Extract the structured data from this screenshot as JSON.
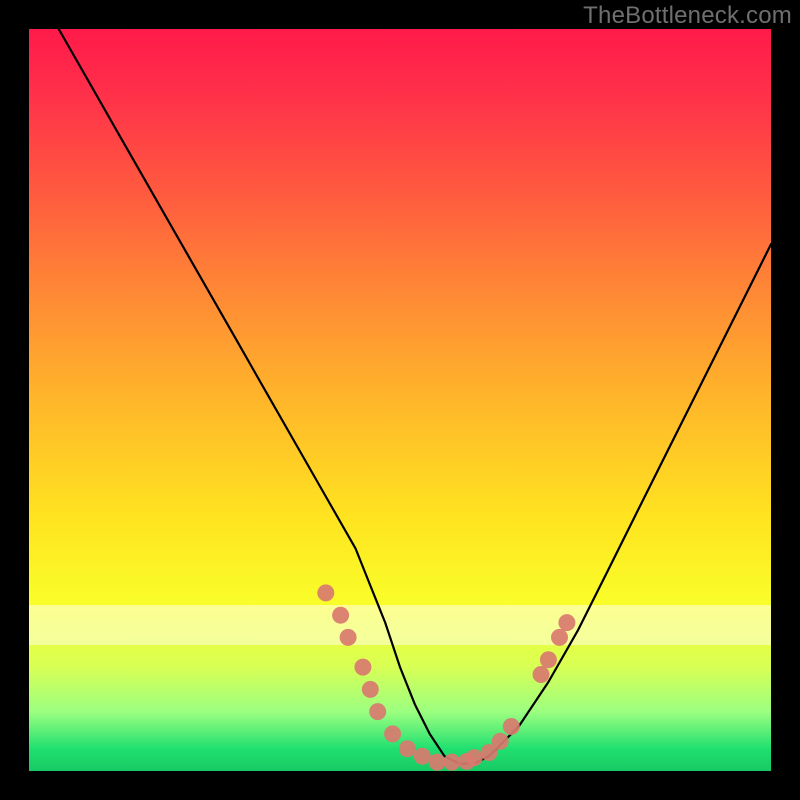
{
  "watermark": "TheBottleneck.com",
  "chart_data": {
    "type": "line",
    "title": "",
    "xlabel": "",
    "ylabel": "",
    "xlim": [
      0,
      100
    ],
    "ylim": [
      0,
      100
    ],
    "grid": false,
    "legend": false,
    "series": [
      {
        "name": "bottleneck-curve",
        "x": [
          4,
          8,
          12,
          16,
          20,
          24,
          28,
          32,
          36,
          40,
          44,
          46,
          48,
          50,
          52,
          54,
          56,
          58,
          60,
          62,
          66,
          70,
          74,
          78,
          82,
          86,
          90,
          94,
          98,
          100
        ],
        "values": [
          100,
          93,
          86,
          79,
          72,
          65,
          58,
          51,
          44,
          37,
          30,
          25,
          20,
          14,
          9,
          5,
          2,
          1,
          1,
          2,
          6,
          12,
          19,
          27,
          35,
          43,
          51,
          59,
          67,
          71
        ]
      }
    ],
    "markers": {
      "name": "highlight-band",
      "color": "#d9796f",
      "points": [
        {
          "x": 40,
          "y": 24
        },
        {
          "x": 42,
          "y": 21
        },
        {
          "x": 43,
          "y": 18
        },
        {
          "x": 45,
          "y": 14
        },
        {
          "x": 46,
          "y": 11
        },
        {
          "x": 47,
          "y": 8
        },
        {
          "x": 49,
          "y": 5
        },
        {
          "x": 51,
          "y": 3
        },
        {
          "x": 53,
          "y": 2
        },
        {
          "x": 55,
          "y": 1.2
        },
        {
          "x": 57,
          "y": 1.2
        },
        {
          "x": 59,
          "y": 1.3
        },
        {
          "x": 60,
          "y": 1.8
        },
        {
          "x": 62,
          "y": 2.5
        },
        {
          "x": 63.5,
          "y": 4
        },
        {
          "x": 65,
          "y": 6
        },
        {
          "x": 69,
          "y": 13
        },
        {
          "x": 70,
          "y": 15
        },
        {
          "x": 71.5,
          "y": 18
        },
        {
          "x": 72.5,
          "y": 20
        }
      ]
    }
  }
}
